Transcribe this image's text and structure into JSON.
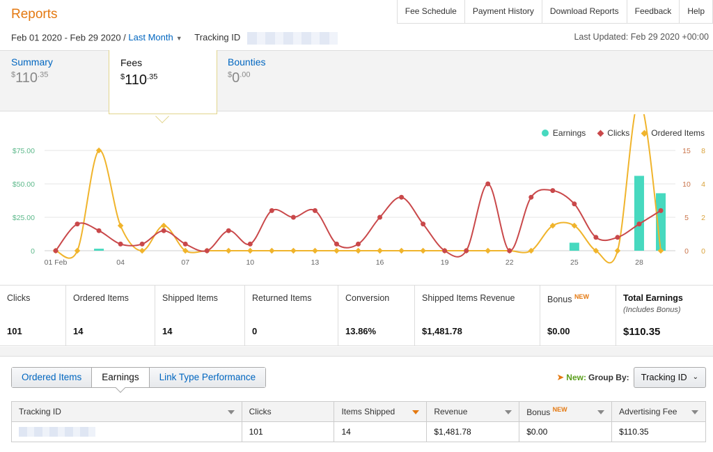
{
  "header": {
    "title": "Reports",
    "top_links": [
      "Fee Schedule",
      "Payment History",
      "Download Reports",
      "Feedback",
      "Help"
    ],
    "date_range": "Feb 01 2020 - Feb 29 2020 /",
    "range_link": "Last Month",
    "tracking_label": "Tracking ID",
    "last_updated": "Last Updated: Feb 29 2020 +00:00"
  },
  "summary_tabs": {
    "summary": {
      "label": "Summary",
      "currency": "$",
      "whole": "110",
      "cents": ".35"
    },
    "fees": {
      "label": "Fees",
      "currency": "$",
      "whole": "110",
      "cents": ".35"
    },
    "bounties": {
      "label": "Bounties",
      "currency": "$",
      "whole": "0",
      "cents": ".00"
    }
  },
  "legend": {
    "earnings": "Earnings",
    "clicks": "Clicks",
    "ordered": "Ordered Items"
  },
  "colors": {
    "earnings": "#47d9bf",
    "clicks": "#c9484a",
    "ordered": "#f0b42c",
    "accent": "#e47911",
    "link": "#0066c0"
  },
  "chart_data": {
    "type": "line",
    "x": [
      "01 Feb",
      "02",
      "03",
      "04",
      "05",
      "06",
      "07",
      "08",
      "09",
      "10",
      "11",
      "12",
      "13",
      "14",
      "15",
      "16",
      "17",
      "18",
      "19",
      "20",
      "21",
      "22",
      "23",
      "24",
      "25",
      "26",
      "27",
      "28",
      "29"
    ],
    "x_tick_labels": [
      "01 Feb",
      "04",
      "07",
      "10",
      "13",
      "16",
      "19",
      "22",
      "25",
      "28"
    ],
    "y_left": {
      "ticks": [
        "0",
        "$25.00",
        "$50.00",
        "$75.00"
      ],
      "range": [
        0,
        75
      ]
    },
    "y_clicks": {
      "ticks": [
        "0",
        "5",
        "10",
        "15"
      ],
      "range": [
        0,
        15
      ]
    },
    "y_ordered": {
      "ticks": [
        "0",
        "2",
        "4",
        "8"
      ],
      "range": [
        0,
        8
      ]
    },
    "series": [
      {
        "name": "Earnings",
        "type": "bar",
        "axis": "left",
        "values": [
          0,
          0,
          1.5,
          0,
          0,
          0,
          0,
          0,
          0,
          0,
          0,
          0,
          0,
          0,
          0,
          0,
          0,
          0,
          0,
          0,
          0,
          0,
          0,
          0,
          6,
          0,
          0,
          56,
          43
        ]
      },
      {
        "name": "Clicks",
        "type": "line",
        "axis": "clicks",
        "values": [
          0,
          4,
          3,
          1,
          1,
          3,
          1,
          0,
          3,
          1,
          6,
          5,
          6,
          1,
          1,
          5,
          8,
          4,
          0,
          0,
          10,
          0,
          8,
          9,
          7,
          2,
          2,
          4,
          6
        ]
      },
      {
        "name": "Ordered Items",
        "type": "line",
        "axis": "ordered",
        "values": [
          0,
          0,
          8,
          2,
          0,
          2,
          0,
          0,
          0,
          0,
          0,
          0,
          0,
          0,
          0,
          0,
          0,
          0,
          0,
          0,
          0,
          0,
          0,
          2,
          2,
          0,
          0,
          12,
          0
        ]
      }
    ]
  },
  "stats": [
    {
      "label": "Clicks",
      "value": "101"
    },
    {
      "label": "Ordered Items",
      "value": "14"
    },
    {
      "label": "Shipped Items",
      "value": "14"
    },
    {
      "label": "Returned Items",
      "value": "0"
    },
    {
      "label": "Conversion",
      "value": "13.86%"
    },
    {
      "label": "Shipped Items Revenue",
      "value": "$1,481.78"
    },
    {
      "label": "Bonus",
      "badge": "NEW",
      "value": "$0.00"
    },
    {
      "label": "Total Earnings",
      "sub": "(Includes Bonus)",
      "value": "$110.35"
    }
  ],
  "bottom_tabs": [
    "Ordered Items",
    "Earnings",
    "Link Type Performance"
  ],
  "groupby": {
    "new": "New:",
    "label": "Group By:",
    "value": "Tracking ID"
  },
  "table": {
    "headers": [
      "Tracking ID",
      "Clicks",
      "Items Shipped",
      "Revenue",
      "Bonus",
      "Advertising Fee"
    ],
    "bonus_badge": "NEW",
    "row": [
      "",
      "101",
      "14",
      "$1,481.78",
      "$0.00",
      "$110.35"
    ]
  }
}
